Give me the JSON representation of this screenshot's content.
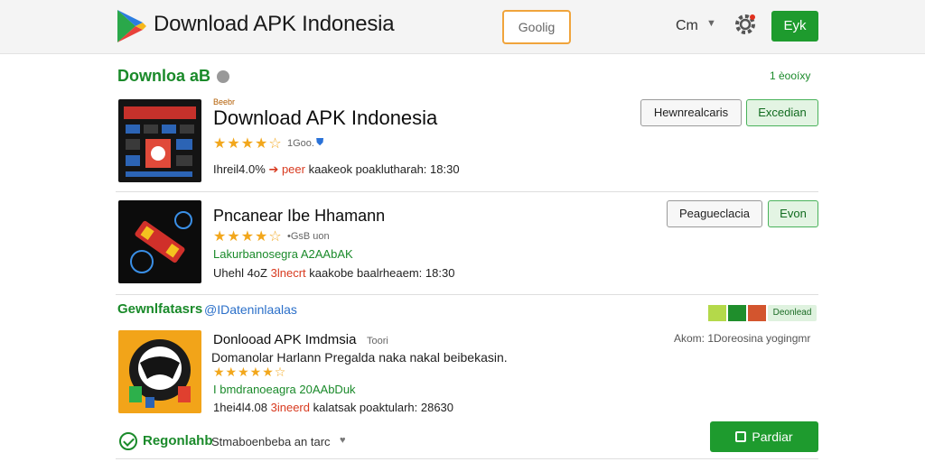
{
  "header": {
    "brand": "Download APK Indonesia",
    "search_label": "Goolig",
    "language": "Cm",
    "action_label": "Eyk"
  },
  "section1": {
    "title": "Downloa aB",
    "meta": "1  èooíxy"
  },
  "apps": [
    {
      "small_label": "Beebr",
      "title": "Download APK Indonesia",
      "stars": "★★★★☆",
      "rating_note": "1Goo.",
      "meta_prefix": "Ihreil4.0%",
      "meta_highlight": "➔ peer",
      "meta_suffix": "kaakeok poaklutharah: 18:30",
      "btn_secondary": "Hewnrealcaris",
      "btn_primary": "Excedian"
    },
    {
      "title": "Pncanear Ibe Hhamann",
      "stars": "★★★★☆",
      "rating_note": "•GsB uon",
      "green_line": "Lakurbanosegra A2AAbAK",
      "meta_prefix": "Uhehl 4oZ",
      "meta_highlight": "3lnecrt",
      "meta_suffix": "kaakobe baalrheaem: 18:30",
      "btn_secondary": "Peagueclacia",
      "btn_primary": "Evon"
    },
    {
      "title": "Donlooad APK Imdmsia",
      "title_note": "Toori",
      "stars": "★★★★★☆",
      "green_line": "I bmdranoeagra 20AAbDuk",
      "meta_prefix": "1hei4l4.08",
      "meta_highlight": "3ineerd",
      "meta_suffix": "kalatsak poaktularh: 28630"
    }
  ],
  "section2": {
    "title": "Gewnlfatasrs",
    "subtitle": "@IDateninlaalas",
    "swatch_label": "Deonlead",
    "swatches": [
      "#b4d94a",
      "#1f8e2c",
      "#d3552e"
    ],
    "aside_note": "Akom: 1Doreosina yogingmr",
    "description": "Domanolar Harlann Pregalda naka nakal beibekasin."
  },
  "footer": {
    "brand": "Regonlahb",
    "text": "Stmaboenbeba an tarc",
    "button": "Pardiar"
  },
  "colors": {
    "brand_green": "#1e9b2e",
    "accent_orange": "#f0a43c",
    "star_gold": "#f2a71c"
  }
}
